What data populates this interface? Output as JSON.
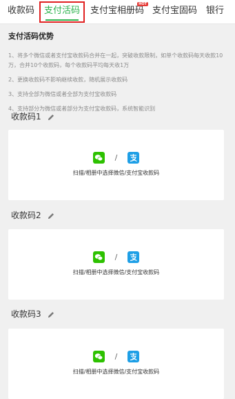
{
  "tabs": [
    {
      "label": "收款码"
    },
    {
      "label": "支付活码"
    },
    {
      "label": "支付宝相册码",
      "badge": "HOT"
    },
    {
      "label": "支付宝固码"
    },
    {
      "label": "银行"
    }
  ],
  "advantages": {
    "title": "支付活码优势",
    "items": [
      "1、将多个微信或者支付宝收款码合并在一起，突破收款限制，如单个收款码每天收款10万，合并10个收款码，每个收款码平均每天收1万",
      "2、更换收款码不影响继续收款，随机展示收款码",
      "3、支持全部为微信或者全部为支付宝收款码",
      "4、支持部分为微信或者部分为支付宝收款码，系统智能识别"
    ]
  },
  "codes": [
    {
      "title": "收款码1",
      "separator": "/",
      "instruction": "扫描/相册中选择微信/支付宝收款码"
    },
    {
      "title": "收款码2",
      "separator": "/",
      "instruction": "扫描/相册中选择微信/支付宝收款码"
    },
    {
      "title": "收款码3",
      "separator": "/",
      "instruction": "扫描/相册中选择微信/支付宝收款码"
    }
  ],
  "colors": {
    "accent": "#2bb24c",
    "highlight": "#e02020",
    "wechat": "#2dc100",
    "alipay": "#1e9fe6"
  },
  "icons": {
    "edit": "pencil-icon",
    "wechat": "wechat-icon",
    "alipay": "alipay-icon"
  }
}
